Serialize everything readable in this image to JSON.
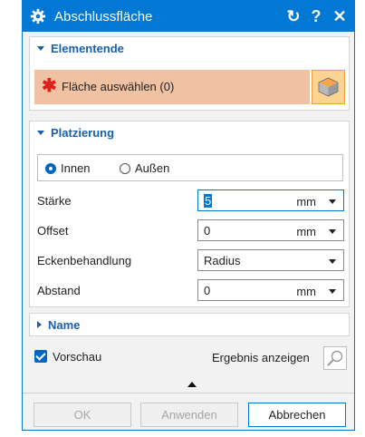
{
  "window": {
    "title": "Abschlussfläche",
    "reset_glyph": "↻",
    "help_glyph": "?",
    "close_glyph": "✕"
  },
  "sections": {
    "elementende": {
      "header": "Elementende",
      "select_marker": "✱",
      "select_label": "Fläche auswählen (0)"
    },
    "platzierung": {
      "header": "Platzierung",
      "radio_innen": "Innen",
      "radio_aussen": "Außen",
      "selected": "Innen",
      "rows": [
        {
          "label": "Stärke",
          "value": "5",
          "unit": "mm"
        },
        {
          "label": "Offset",
          "value": "0",
          "unit": "mm"
        },
        {
          "label": "Eckenbehandlung",
          "value": "Radius"
        },
        {
          "label": "Abstand",
          "value": "0",
          "unit": "mm"
        }
      ]
    },
    "name": {
      "header": "Name"
    }
  },
  "preview": {
    "label": "Vorschau",
    "checked": true,
    "result_label": "Ergebnis anzeigen"
  },
  "buttons": {
    "ok": "OK",
    "apply": "Anwenden",
    "cancel": "Abbrechen"
  },
  "colors": {
    "accent": "#0078d4",
    "selection_row": "#f0c2a3",
    "required_star": "#e0201b",
    "face_button": "#fbd493"
  }
}
